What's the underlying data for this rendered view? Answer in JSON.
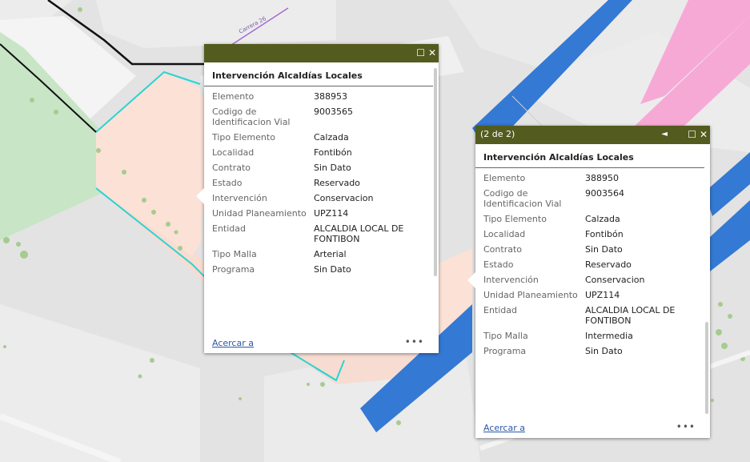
{
  "colors": {
    "popup_header": "#545b1f",
    "parcel_fill": "#fbe0d6",
    "outline": "#26d6d6",
    "blue_band": "#3278d2",
    "pink_band": "#f7a8d5",
    "green_area": "#c6e4c6",
    "link": "#2a58a8"
  },
  "map": {
    "street_label": "Carrera 26"
  },
  "popup_left": {
    "maximize_icon": "maximize-icon",
    "close_label": "✕",
    "maximize_label": "☐",
    "title": "Intervención Alcaldías Locales",
    "fields": [
      {
        "label": "Elemento",
        "value": "388953"
      },
      {
        "label": "Codigo de Identificacion Vial",
        "value": "9003565"
      },
      {
        "label": "Tipo Elemento",
        "value": "Calzada"
      },
      {
        "label": "Localidad",
        "value": "Fontibón"
      },
      {
        "label": "Contrato",
        "value": "Sin Dato"
      },
      {
        "label": "Estado",
        "value": "Reservado"
      },
      {
        "label": "Intervención",
        "value": "Conservacion"
      },
      {
        "label": "Unidad Planeamiento",
        "value": "UPZ114"
      },
      {
        "label": "Entidad",
        "value": "ALCALDIA LOCAL DE FONTIBON"
      },
      {
        "label": "Tipo Malla",
        "value": "Arterial"
      },
      {
        "label": "Programa",
        "value": "Sin Dato"
      }
    ],
    "zoom_link": "Acercar a",
    "more_label": "•••"
  },
  "popup_right": {
    "count": "(2 de 2)",
    "prev_label": "◄",
    "close_label": "✕",
    "maximize_label": "☐",
    "title": "Intervención Alcaldías Locales",
    "fields": [
      {
        "label": "Elemento",
        "value": "388950"
      },
      {
        "label": "Codigo de Identificacion Vial",
        "value": "9003564"
      },
      {
        "label": "Tipo Elemento",
        "value": "Calzada"
      },
      {
        "label": "Localidad",
        "value": "Fontibón"
      },
      {
        "label": "Contrato",
        "value": "Sin Dato"
      },
      {
        "label": "Estado",
        "value": "Reservado"
      },
      {
        "label": "Intervención",
        "value": "Conservacion"
      },
      {
        "label": "Unidad Planeamiento",
        "value": "UPZ114"
      },
      {
        "label": "Entidad",
        "value": "ALCALDIA LOCAL DE FONTIBON"
      },
      {
        "label": "Tipo Malla",
        "value": "Intermedia"
      },
      {
        "label": "Programa",
        "value": "Sin Dato"
      }
    ],
    "zoom_link": "Acercar a",
    "more_label": "•••"
  }
}
